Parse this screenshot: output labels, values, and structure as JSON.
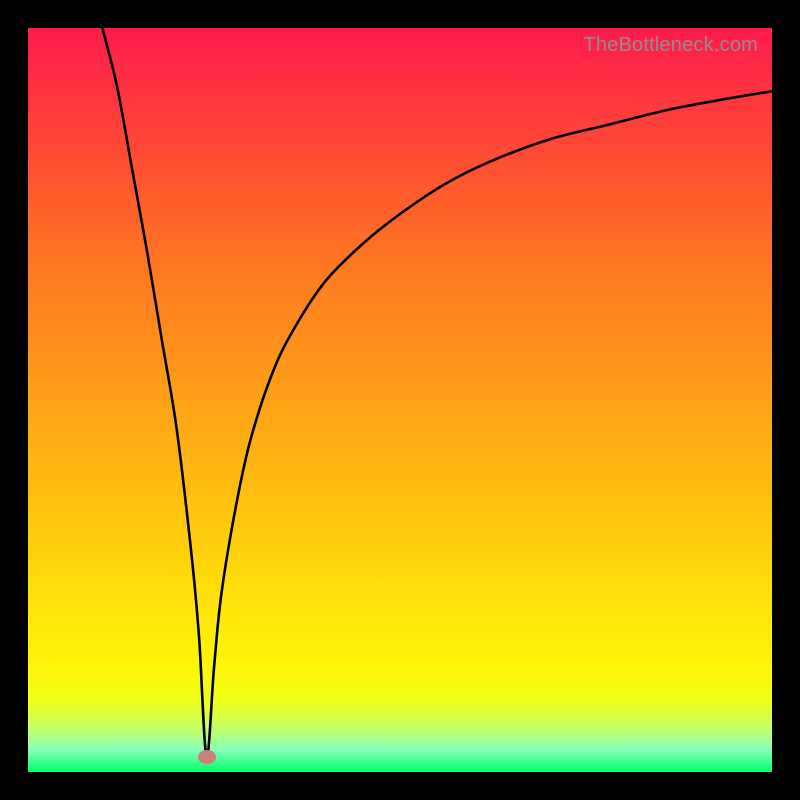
{
  "watermark": "TheBottleneck.com",
  "chart_data": {
    "type": "line",
    "title": "",
    "xlabel": "",
    "ylabel": "",
    "xlim": [
      0,
      100
    ],
    "ylim": [
      0,
      100
    ],
    "grid": false,
    "legend": false,
    "marker": {
      "x": 24,
      "y": 2
    },
    "series": [
      {
        "name": "curve",
        "x": [
          10,
          12,
          14,
          16,
          18,
          20,
          22,
          23,
          24,
          25,
          26,
          28,
          30,
          33,
          36,
          40,
          45,
          50,
          56,
          62,
          70,
          78,
          86,
          94,
          100
        ],
        "y": [
          100,
          92,
          81,
          70,
          58,
          46,
          29,
          18,
          2,
          14,
          24,
          36,
          45,
          54,
          60,
          66,
          71,
          75,
          79,
          82,
          85,
          87,
          89,
          90.5,
          91.5
        ]
      }
    ]
  }
}
